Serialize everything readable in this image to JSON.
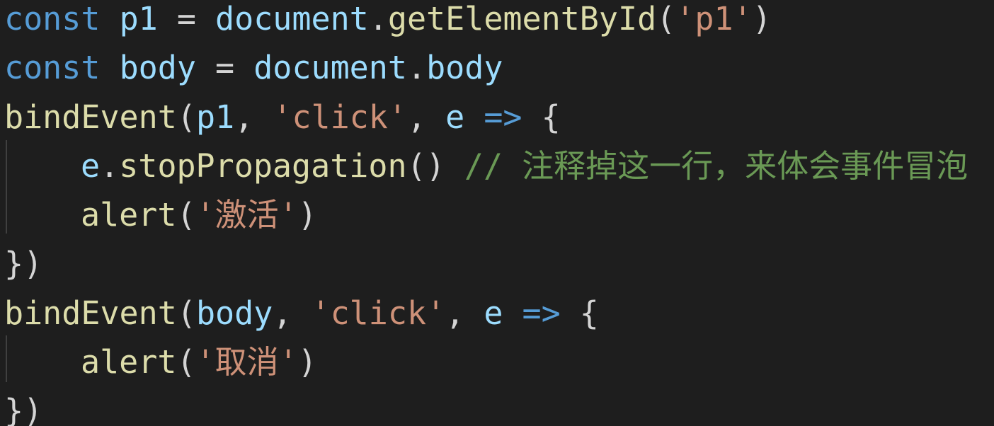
{
  "editor": {
    "lines": [
      {
        "tokens": [
          {
            "type": "kw",
            "text": "const"
          },
          {
            "type": "punc",
            "text": " "
          },
          {
            "type": "var",
            "text": "p1"
          },
          {
            "type": "punc",
            "text": " = "
          },
          {
            "type": "var",
            "text": "document"
          },
          {
            "type": "punc",
            "text": "."
          },
          {
            "type": "fn",
            "text": "getElementById"
          },
          {
            "type": "punc",
            "text": "("
          },
          {
            "type": "str",
            "text": "'p1'"
          },
          {
            "type": "punc",
            "text": ")"
          }
        ]
      },
      {
        "tokens": [
          {
            "type": "kw",
            "text": "const"
          },
          {
            "type": "punc",
            "text": " "
          },
          {
            "type": "var",
            "text": "body"
          },
          {
            "type": "punc",
            "text": " = "
          },
          {
            "type": "var",
            "text": "document"
          },
          {
            "type": "punc",
            "text": "."
          },
          {
            "type": "var",
            "text": "body"
          }
        ]
      },
      {
        "tokens": [
          {
            "type": "fn",
            "text": "bindEvent"
          },
          {
            "type": "punc",
            "text": "("
          },
          {
            "type": "var",
            "text": "p1"
          },
          {
            "type": "punc",
            "text": ", "
          },
          {
            "type": "str",
            "text": "'click'"
          },
          {
            "type": "punc",
            "text": ", "
          },
          {
            "type": "param",
            "text": "e"
          },
          {
            "type": "punc",
            "text": " "
          },
          {
            "type": "kw",
            "text": "=>"
          },
          {
            "type": "punc",
            "text": " {"
          }
        ]
      },
      {
        "indent": true,
        "tokens": [
          {
            "type": "param",
            "text": "e"
          },
          {
            "type": "punc",
            "text": "."
          },
          {
            "type": "fn",
            "text": "stopPropagation"
          },
          {
            "type": "punc",
            "text": "() "
          },
          {
            "type": "comment",
            "text": "// 注释掉这一行，来体会事件冒泡"
          }
        ]
      },
      {
        "indent": true,
        "tokens": [
          {
            "type": "fn",
            "text": "alert"
          },
          {
            "type": "punc",
            "text": "("
          },
          {
            "type": "str",
            "text": "'激活'"
          },
          {
            "type": "punc",
            "text": ")"
          }
        ]
      },
      {
        "tokens": [
          {
            "type": "punc",
            "text": "})"
          }
        ]
      },
      {
        "tokens": [
          {
            "type": "fn",
            "text": "bindEvent"
          },
          {
            "type": "punc",
            "text": "("
          },
          {
            "type": "var",
            "text": "body"
          },
          {
            "type": "punc",
            "text": ", "
          },
          {
            "type": "str",
            "text": "'click'"
          },
          {
            "type": "punc",
            "text": ", "
          },
          {
            "type": "param",
            "text": "e"
          },
          {
            "type": "punc",
            "text": " "
          },
          {
            "type": "kw",
            "text": "=>"
          },
          {
            "type": "punc",
            "text": " {"
          }
        ]
      },
      {
        "indent": true,
        "tokens": [
          {
            "type": "fn",
            "text": "alert"
          },
          {
            "type": "punc",
            "text": "("
          },
          {
            "type": "str",
            "text": "'取消'"
          },
          {
            "type": "punc",
            "text": ")"
          }
        ]
      },
      {
        "tokens": [
          {
            "type": "punc",
            "text": "})"
          }
        ]
      }
    ]
  },
  "theme": {
    "background": "#1e1e1e",
    "keyword": "#569cd6",
    "variable": "#9cdcfe",
    "function": "#dcdcaa",
    "string": "#ce9178",
    "comment": "#6a9955",
    "punctuation": "#d4d4d4"
  }
}
